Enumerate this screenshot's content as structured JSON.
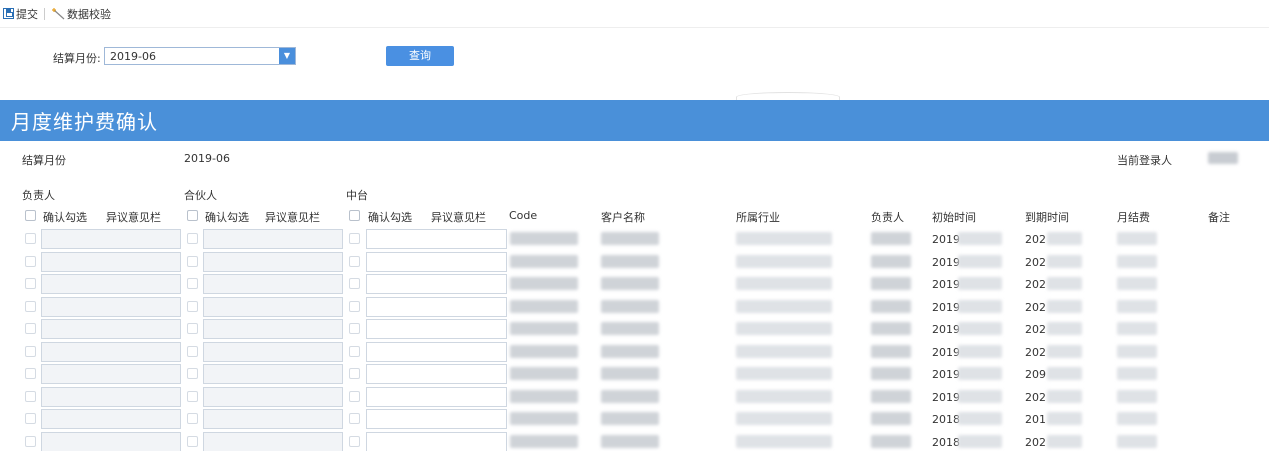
{
  "toolbar": {
    "submit": "提交",
    "validate": "数据校验"
  },
  "filter": {
    "label": "结算月份:",
    "value": "2019-06",
    "query": "查询"
  },
  "banner": {
    "title": "月度维护费确认"
  },
  "info": {
    "month_label": "结算月份",
    "month_value": "2019-06",
    "login_label": "当前登录人"
  },
  "groups": {
    "owner": "负责人",
    "partner": "合伙人",
    "center": "中台"
  },
  "headers": {
    "confirm": "确认勾选",
    "objection": "异议意见栏",
    "code": "Code",
    "customer": "客户名称",
    "industry": "所属行业",
    "owner": "负责人",
    "start": "初始时间",
    "end": "到期时间",
    "fee": "月结费",
    "remark": "备注"
  },
  "rows": [
    {
      "start": "2019",
      "end": "202"
    },
    {
      "start": "2019",
      "end": "202"
    },
    {
      "start": "2019",
      "end": "202"
    },
    {
      "start": "2019",
      "end": "202"
    },
    {
      "start": "2019",
      "end": "202"
    },
    {
      "start": "2019",
      "end": "202"
    },
    {
      "start": "2019",
      "end": "209"
    },
    {
      "start": "2019",
      "end": "202"
    },
    {
      "start": "2018",
      "end": "201"
    },
    {
      "start": "2018",
      "end": "202"
    }
  ],
  "colors": {
    "accent": "#4a90d9",
    "button": "#4a90e2"
  }
}
